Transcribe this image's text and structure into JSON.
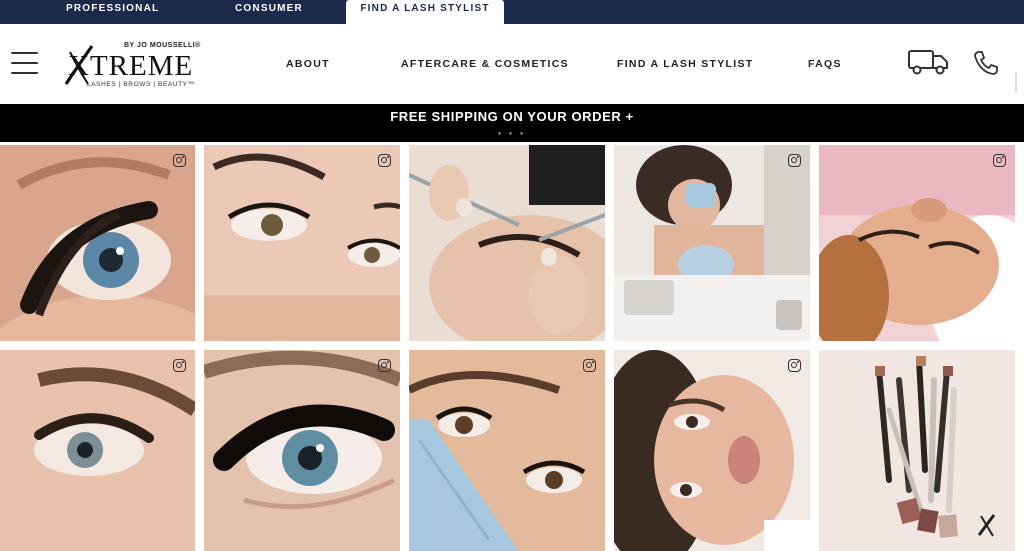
{
  "segments": [
    {
      "label": "PROFESSIONAL"
    },
    {
      "label": "CONSUMER"
    },
    {
      "label": "FIND A LASH STYLIST",
      "active": true
    }
  ],
  "header": {
    "logo": {
      "by_line": "BY JO MOUSSELLI®",
      "wordmark": "XTREME",
      "tagline": "LASHES | BROWS | BEAUTY™"
    },
    "nav": [
      "ABOUT",
      "AFTERCARE & COSMETICS",
      "FIND A LASH STYLIST",
      "FAQS"
    ],
    "icons": {
      "shipping": "truck-icon",
      "contact": "phone-icon",
      "menu": "hamburger-icon"
    }
  },
  "promo": {
    "text": "FREE SHIPPING ON YOUR ORDER  +",
    "dots": "• • •"
  },
  "gallery": {
    "tiles": [
      {
        "subject": "close-up of blue eye with volume lashes",
        "icon": "instagram-icon"
      },
      {
        "subject": "face with classic lash extensions",
        "icon": "instagram-icon"
      },
      {
        "subject": "stylist applying lashes with tweezers"
      },
      {
        "subject": "lash technician working on client",
        "icon": "instagram-icon"
      },
      {
        "subject": "client lying with lashes applied",
        "icon": "instagram-icon"
      },
      {
        "subject": "eye with curled lash extensions",
        "icon": "instagram-icon"
      },
      {
        "subject": "blue eye with dark volume lashes",
        "icon": "instagram-icon"
      },
      {
        "subject": "woman with face mask and lashes",
        "icon": "instagram-icon"
      },
      {
        "subject": "woman with full makeup and lashes",
        "icon": "instagram-icon"
      },
      {
        "subject": "cosmetic pencils product shot"
      }
    ]
  },
  "colors": {
    "nav_bg": "#1b2a4a",
    "promo_bg": "#000000",
    "accent_text": "#222222"
  }
}
